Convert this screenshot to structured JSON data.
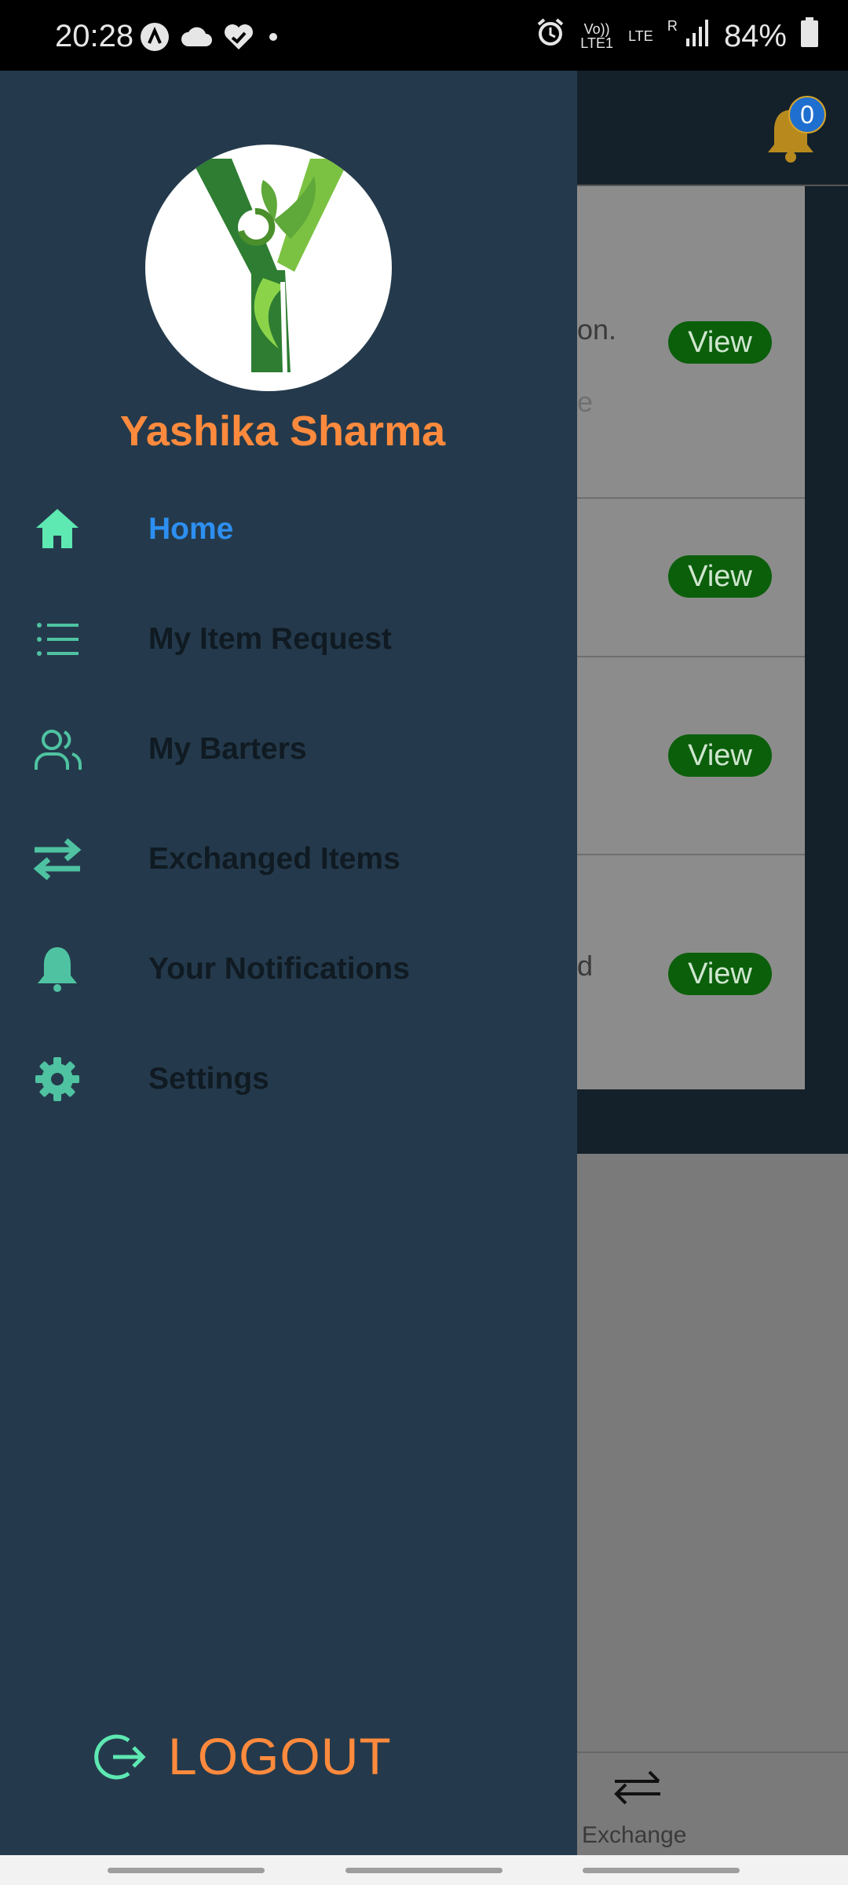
{
  "status_bar": {
    "time": "20:28",
    "volte_label": "Vo)) LTE1",
    "lte_label": "LTE",
    "roaming": "R",
    "battery": "84%",
    "left_icons": [
      "app-a-icon",
      "cloud-icon",
      "heart-check-icon",
      "dot-icon"
    ],
    "right_icons": [
      "alarm-icon",
      "signal-icon",
      "battery-icon"
    ]
  },
  "background_app": {
    "notification_count": "0",
    "list_items": [
      {
        "text": "on.",
        "extra": "e",
        "button_label": "View"
      },
      {
        "text": "",
        "button_label": "View"
      },
      {
        "text": "",
        "button_label": "View"
      },
      {
        "text": "d",
        "button_label": "View"
      }
    ],
    "tab_label": "Exchange"
  },
  "drawer": {
    "user_name": "Yashika Sharma",
    "menu": [
      {
        "label": "Home",
        "icon": "home-icon",
        "active": true
      },
      {
        "label": "My Item Request",
        "icon": "list-icon",
        "active": false
      },
      {
        "label": "My Barters",
        "icon": "users-icon",
        "active": false
      },
      {
        "label": "Exchanged Items",
        "icon": "exchange-icon",
        "active": false
      },
      {
        "label": "Your Notifications",
        "icon": "bell-icon",
        "active": false
      },
      {
        "label": "Settings",
        "icon": "gear-icon",
        "active": false
      }
    ],
    "logout_label": "LOGOUT"
  },
  "colors": {
    "drawer_bg": "#243a4c",
    "accent_orange": "#ff8a3d",
    "icon_teal": "#4fc3a1",
    "active_blue": "#2d8ff0",
    "view_button": "#0b5f0b"
  }
}
